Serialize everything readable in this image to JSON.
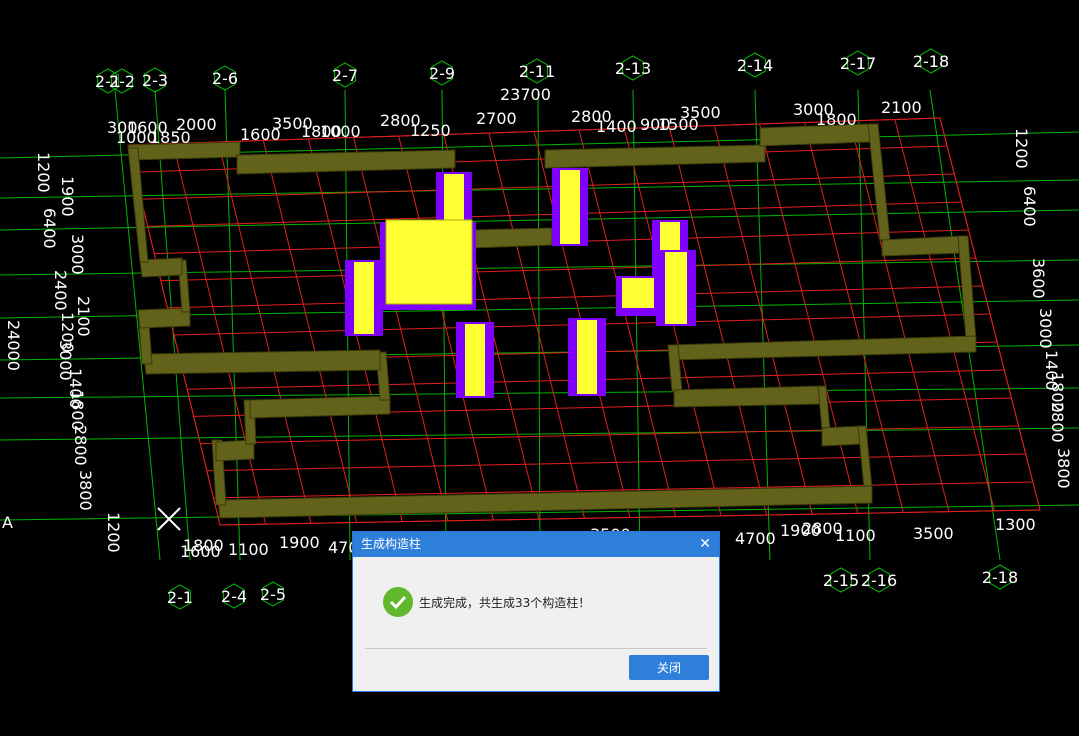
{
  "viewport": {
    "top_axes": [
      "2-1",
      "2-2",
      "2-3",
      "2-6",
      "2-7",
      "2-9",
      "2-11",
      "2-13",
      "2-14",
      "2-17",
      "2-18"
    ],
    "bottom_axes": [
      "2-1",
      "2-4",
      "2-5",
      "2-15",
      "2-16",
      "2-18"
    ],
    "left_axis": "A",
    "top_total": "23700",
    "top_dims": [
      "300",
      "1000",
      "1600",
      "1850",
      "2000",
      "1600",
      "3500",
      "1800",
      "1000",
      "2800",
      "1250",
      "2700",
      "2800",
      "1400",
      "900",
      "1500",
      "3500",
      "3000",
      "1800",
      "2100"
    ],
    "bottom_dims": [
      "1800",
      "1600",
      "1100",
      "1900",
      "4700",
      "3500",
      "4700",
      "1900",
      "2800",
      "1100",
      "3500",
      "1300"
    ],
    "left_total": "24000",
    "left_dims": [
      "1200",
      "6400",
      "1900",
      "3000",
      "2400",
      "2100",
      "1200",
      "3000",
      "1400",
      "1800",
      "2800",
      "3800",
      "1200"
    ],
    "right_dims": [
      "1200",
      "6400",
      "3600",
      "3000",
      "1400",
      "1800",
      "2800",
      "3800"
    ],
    "colors": {
      "wall": "#62621a",
      "column_core": "#ffff33",
      "column_edge": "#7f00ff",
      "axis": "#00c800",
      "grid": "#e02020",
      "text": "#ffffff"
    }
  },
  "dialog": {
    "title": "生成构造柱",
    "close_icon": "close-icon",
    "status_icon": "success-check-icon",
    "message": "生成完成，共生成33个构造柱！",
    "close_button_label": "关闭"
  }
}
